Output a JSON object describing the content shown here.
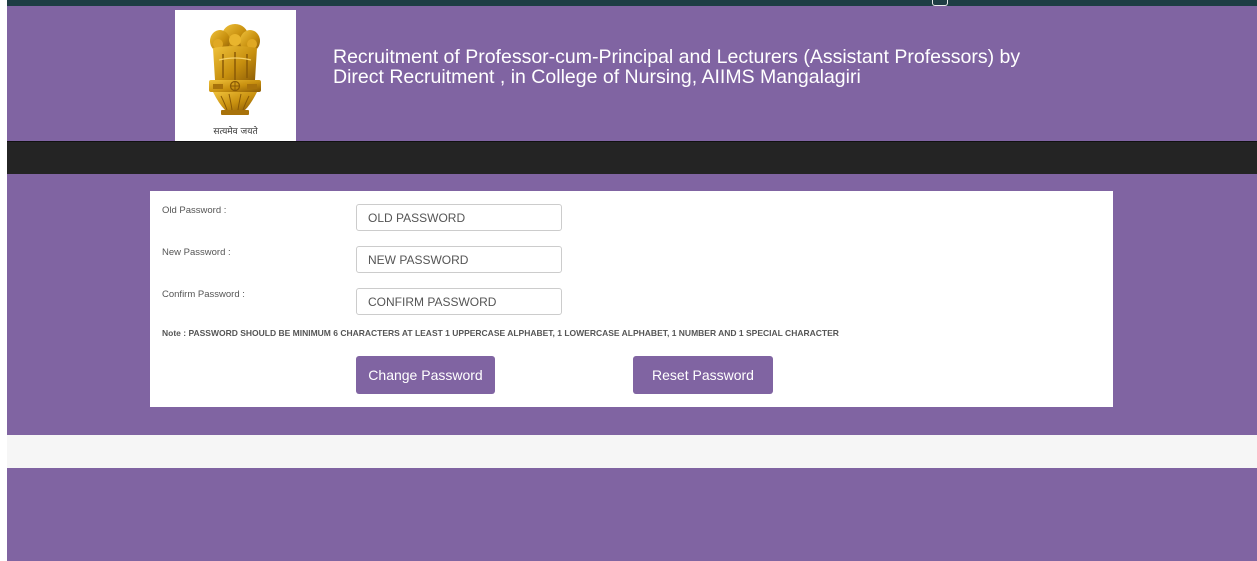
{
  "header": {
    "emblem_motto": "सत्यमेव जयते",
    "title_line1": "Recruitment of Professor-cum-Principal and Lecturers (Assistant Professors) by",
    "title_line2": "Direct Recruitment , in College of Nursing, AIIMS Mangalagiri"
  },
  "form": {
    "old_password": {
      "label": "Old Password :",
      "placeholder": "OLD PASSWORD",
      "value": ""
    },
    "new_password": {
      "label": "New Password :",
      "placeholder": "NEW PASSWORD",
      "value": ""
    },
    "confirm_password": {
      "label": "Confirm Password :",
      "placeholder": "CONFIRM PASSWORD",
      "value": ""
    },
    "note": "Note : PASSWORD SHOULD BE MINIMUM 6 CHARACTERS AT LEAST 1 UPPERCASE ALPHABET, 1 LOWERCASE ALPHABET, 1 NUMBER AND 1 SPECIAL CHARACTER",
    "change_button": "Change Password",
    "reset_button": "Reset Password"
  },
  "icons": {
    "emblem": "national-emblem-icon"
  },
  "colors": {
    "primary": "#8064a2",
    "nav": "#242424",
    "top_bar": "#1e3d44",
    "footer_band": "#f6f6f6",
    "emblem_gold": "#c8900f"
  }
}
